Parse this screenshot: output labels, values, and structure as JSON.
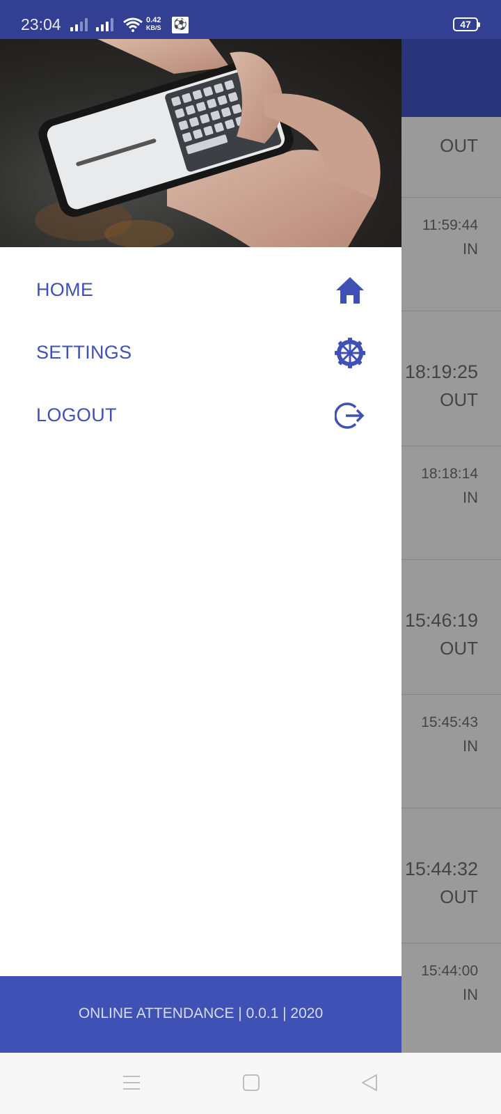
{
  "status_bar": {
    "time": "23:04",
    "net_speed_value": "0.42",
    "net_speed_unit": "KB/S",
    "battery": "47",
    "icons": [
      "signal-1-icon",
      "signal-2-icon",
      "wifi-icon",
      "notification-app-icon",
      "battery-icon"
    ]
  },
  "drawer": {
    "menu": [
      {
        "label": "HOME",
        "icon": "home-icon"
      },
      {
        "label": "SETTINGS",
        "icon": "settings-gear-icon"
      },
      {
        "label": "LOGOUT",
        "icon": "logout-icon"
      }
    ],
    "footer": "ONLINE ATTENDANCE | 0.0.1 | 2020"
  },
  "attendance_list": [
    {
      "time": "",
      "direction": "OUT"
    },
    {
      "time": "11:59:44",
      "direction": "IN"
    },
    {
      "time": "18:19:25",
      "direction": "OUT"
    },
    {
      "time": "18:18:14",
      "direction": "IN"
    },
    {
      "time": "15:46:19",
      "direction": "OUT"
    },
    {
      "time": "15:45:43",
      "direction": "IN"
    },
    {
      "time": "15:44:32",
      "direction": "OUT"
    },
    {
      "time": "15:44:00",
      "direction": "IN"
    }
  ],
  "nav_bar": {
    "icons": [
      "recent-apps-icon",
      "home-nav-icon",
      "back-icon"
    ]
  },
  "colors": {
    "primary": "#3f51b5",
    "status_bar": "#323f93",
    "scrim_list": "#9a9a9a"
  }
}
